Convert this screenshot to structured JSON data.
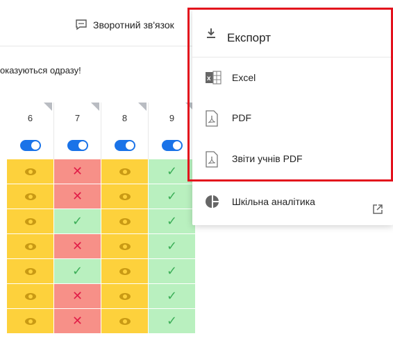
{
  "topbar": {
    "feedback_label": "Зворотний зв'язок"
  },
  "notice": "оказуються одразу!",
  "grid": {
    "columns": [
      "6",
      "7",
      "8",
      "9"
    ],
    "rows": [
      [
        "eye",
        "x",
        "eye",
        "check"
      ],
      [
        "eye",
        "x",
        "eye",
        "check"
      ],
      [
        "eye",
        "check",
        "eye",
        "check"
      ],
      [
        "eye",
        "x",
        "eye",
        "check"
      ],
      [
        "eye",
        "check",
        "eye",
        "check"
      ],
      [
        "eye",
        "x",
        "eye",
        "check"
      ],
      [
        "eye",
        "x",
        "eye",
        "check"
      ]
    ]
  },
  "menu": {
    "title": "Експорт",
    "items": [
      {
        "label": "Excel",
        "icon": "excel-icon"
      },
      {
        "label": "PDF",
        "icon": "pdf-icon"
      },
      {
        "label": "Звіти учнів PDF",
        "icon": "pdf-icon"
      },
      {
        "label": "Шкільна аналітика",
        "icon": "pie-chart-icon"
      }
    ]
  },
  "colors": {
    "accent": "#1a73e8",
    "highlight": "#e3101c",
    "eye_bg": "#fdd13c",
    "x_bg": "#f79088",
    "check_bg": "#b9f0bf"
  }
}
